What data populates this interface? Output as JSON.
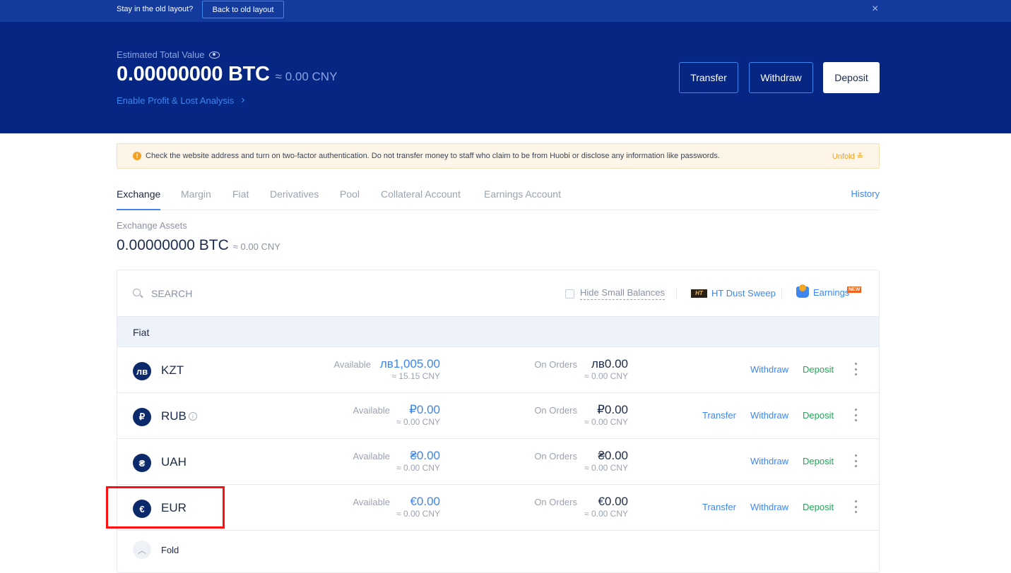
{
  "topbar": {
    "question": "Stay in the old layout?",
    "back_label": "Back to old layout",
    "close_icon": "×"
  },
  "hero": {
    "label": "Estimated Total Value",
    "btc_value": "0.00000000 BTC",
    "cny_value": "≈ 0.00 CNY",
    "profit_link": "Enable Profit & Lost Analysis",
    "chevron": "›",
    "buttons": {
      "transfer": "Transfer",
      "withdraw": "Withdraw",
      "deposit": "Deposit"
    }
  },
  "notice": {
    "icon": "!",
    "text": "Check the website address and turn on two-factor authentication. Do not transfer money to staff who claim to be from Huobi or disclose any information like passwords.",
    "unfold": "Unfold ≚"
  },
  "tabs": [
    {
      "label": "Exchange",
      "active": true
    },
    {
      "label": "Margin"
    },
    {
      "label": "Fiat"
    },
    {
      "label": "Derivatives"
    },
    {
      "label": "Pool"
    },
    {
      "label": "Collateral Account"
    },
    {
      "label": "Earnings Account"
    }
  ],
  "history": "History",
  "exchange_assets": {
    "label": "Exchange Assets",
    "btc_value": "0.00000000 BTC",
    "cny_value": "≈ 0.00 CNY"
  },
  "toolbar": {
    "search_placeholder": "SEARCH",
    "hide_small": "Hide Small Balances",
    "dust_icon": "HT",
    "dust_sweep": "HT Dust Sweep",
    "earnings": "Earnings",
    "new_badge": "NEW"
  },
  "group_label": "Fiat",
  "labels": {
    "available": "Available",
    "on_orders": "On Orders",
    "transfer": "Transfer",
    "withdraw": "Withdraw",
    "deposit": "Deposit"
  },
  "rows": [
    {
      "symbol": "лв",
      "name": "KZT",
      "available": "лв1,005.00",
      "available_cny": "≈ 15.15 CNY",
      "orders": "лв0.00",
      "orders_cny": "≈ 0.00 CNY",
      "transfer": false
    },
    {
      "symbol": "₽",
      "name": "RUB",
      "info": "i",
      "available": "₽0.00",
      "available_cny": "≈ 0.00 CNY",
      "orders": "₽0.00",
      "orders_cny": "≈ 0.00 CNY",
      "transfer": true
    },
    {
      "symbol": "₴",
      "name": "UAH",
      "available": "₴0.00",
      "available_cny": "≈ 0.00 CNY",
      "orders": "₴0.00",
      "orders_cny": "≈ 0.00 CNY",
      "transfer": false
    },
    {
      "symbol": "€",
      "name": "EUR",
      "available": "€0.00",
      "available_cny": "≈ 0.00 CNY",
      "orders": "€0.00",
      "orders_cny": "≈ 0.00 CNY",
      "transfer": true
    }
  ],
  "fold": {
    "icon": "︿",
    "label": "Fold"
  }
}
